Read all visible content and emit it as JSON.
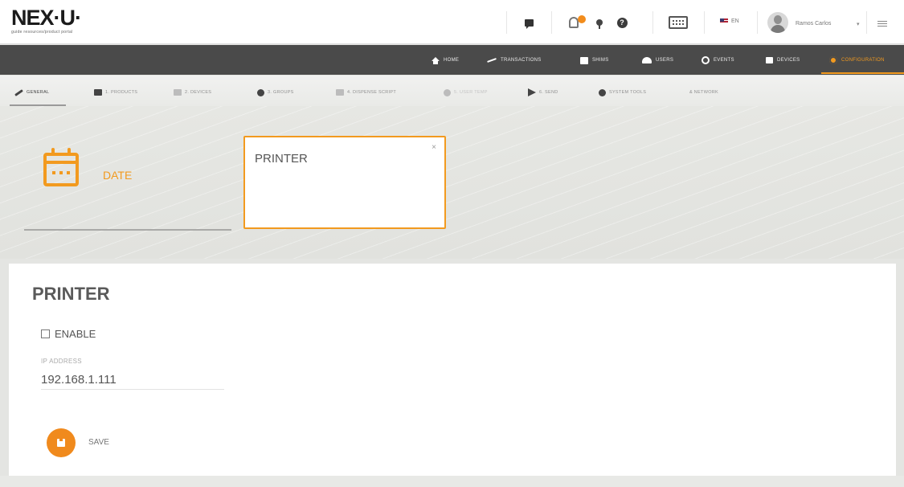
{
  "brand": {
    "logo": "NEX·U·",
    "tagline": "guide resources/product portal"
  },
  "header": {
    "icons": [
      "chat-icon",
      "notification-bell-icon",
      "location-pin-icon",
      "help-icon",
      "keyboard-icon"
    ],
    "language": "EN",
    "user_name": "Ramos Carlos",
    "caret": "▾"
  },
  "nav": {
    "items": [
      {
        "label": "HOME",
        "icon": "home-icon"
      },
      {
        "label": "TRANSACTIONS",
        "icon": "plane-icon"
      },
      {
        "label": "SHIMS",
        "icon": "card-icon"
      },
      {
        "label": "USERS",
        "icon": "users-icon"
      },
      {
        "label": "EVENTS",
        "icon": "clock-icon"
      },
      {
        "label": "DEVICES",
        "icon": "monitor-icon"
      },
      {
        "label": "CONFIGURATION",
        "icon": "gear-icon"
      }
    ],
    "active": "CONFIGURATION"
  },
  "subtabs": {
    "items": [
      {
        "label": "GENERAL"
      },
      {
        "label": "1. PRODUCTS"
      },
      {
        "label": "2. DEVICES"
      },
      {
        "label": "3. GROUPS"
      },
      {
        "label": "4. DISPENSE SCRIPT"
      },
      {
        "label": "5. USER TEMP"
      },
      {
        "label": "6. SEND"
      },
      {
        "label": "SYSTEM TOOLS"
      },
      {
        "label": "& NETWORK"
      }
    ],
    "active": "GENERAL"
  },
  "cards": {
    "date": {
      "label": "DATE"
    },
    "printer": {
      "label": "PRINTER",
      "close": "×"
    }
  },
  "printer_form": {
    "title": "PRINTER",
    "enable_label": "ENABLE",
    "enabled": false,
    "ip_label": "IP ADDRESS",
    "ip_value": "192.168.1.111",
    "save_label": "SAVE"
  },
  "colors": {
    "accent": "#f29a1f",
    "nav_bg": "#4a4a4a",
    "panel_bg": "#ffffff"
  }
}
